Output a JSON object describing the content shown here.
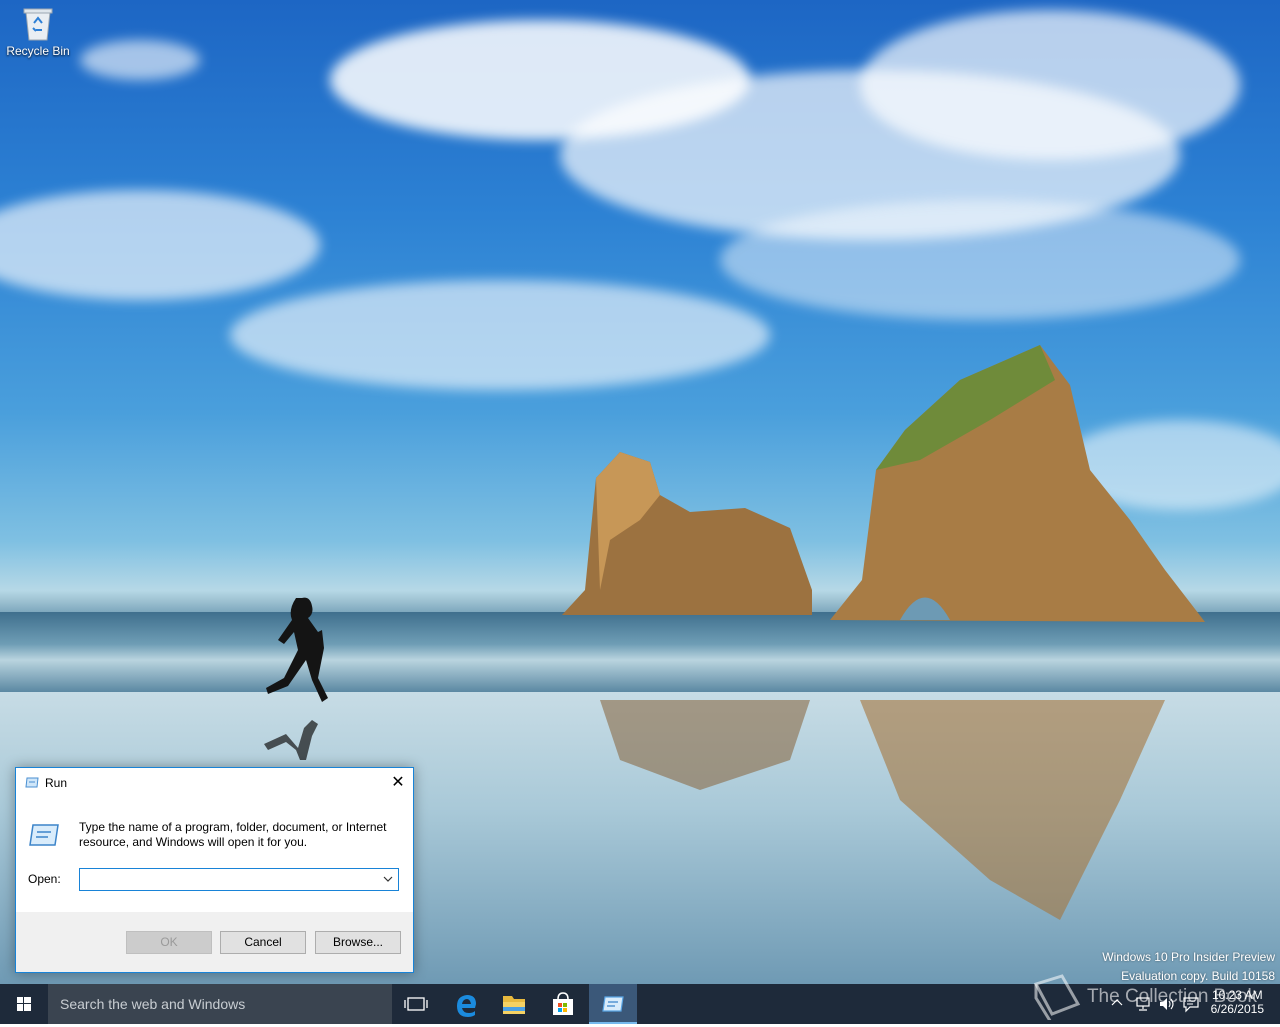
{
  "desktop": {
    "icons": [
      {
        "label": "Recycle Bin",
        "icon": "recycle-bin-icon"
      }
    ],
    "watermark": {
      "line1": "Windows 10 Pro Insider Preview",
      "line2": "Evaluation copy. Build 10158"
    },
    "overlay_text": "The Collection Book"
  },
  "run_dialog": {
    "title": "Run",
    "description": "Type the name of a program, folder, document, or Internet resource, and Windows will open it for you.",
    "open_label": "Open:",
    "open_value": "",
    "buttons": {
      "ok": "OK",
      "cancel": "Cancel",
      "browse": "Browse..."
    },
    "ok_disabled": true,
    "close_glyph": "✕"
  },
  "taskbar": {
    "search_placeholder": "Search the web and Windows",
    "pinned": [
      {
        "icon": "task-view-icon"
      },
      {
        "icon": "edge-icon"
      },
      {
        "icon": "file-explorer-icon"
      },
      {
        "icon": "store-icon"
      },
      {
        "icon": "run-app-icon",
        "active": true
      }
    ],
    "tray": {
      "time": "10:23 AM",
      "date": "6/26/2015",
      "icons": [
        "chevron-up-icon",
        "network-icon",
        "volume-icon",
        "action-center-icon"
      ]
    }
  },
  "colors": {
    "accent": "#1883d7",
    "taskbar": "#1e2a3a",
    "search_box": "#3a4450",
    "dialog_footer": "#f0f0f0"
  }
}
